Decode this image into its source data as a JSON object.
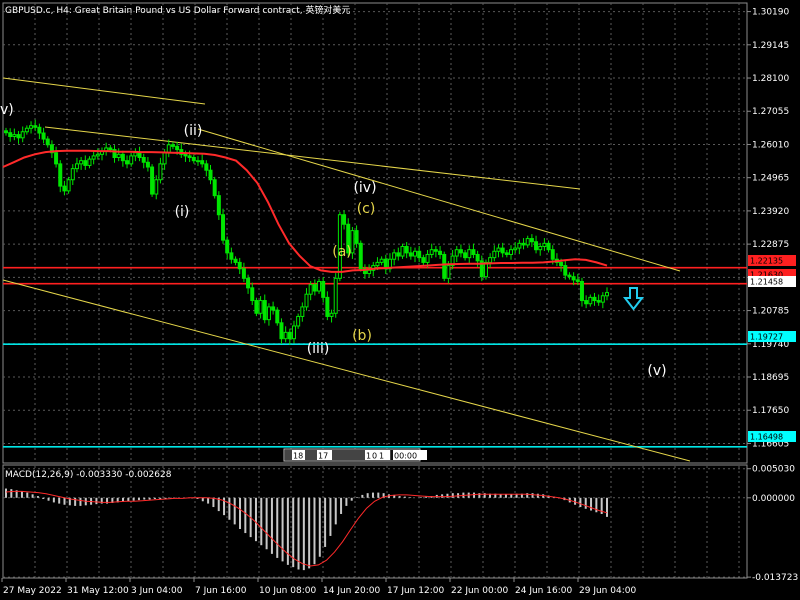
{
  "chart_data": {
    "type": "candlestick",
    "title": "GBPUSD.c, H4:  Great Britain Pound vs US Dollar Forward contract, 英镑对美元",
    "price_axis": {
      "ticks": [
        "1.30190",
        "1.29145",
        "1.28100",
        "1.27055",
        "1.26010",
        "1.24965",
        "1.23920",
        "1.22875",
        "1.21830",
        "1.20785",
        "1.19740",
        "1.18695",
        "1.17650",
        "1.16605"
      ],
      "range": [
        1.1599,
        1.3046
      ]
    },
    "price_labels": [
      {
        "value": "1.22135",
        "bg": "#ff2020"
      },
      {
        "value": "1.21630",
        "bg": "#ff2020"
      },
      {
        "value": "1.21458",
        "bg": "#ffffff"
      },
      {
        "value": "1.19727",
        "bg": "#00ffff"
      },
      {
        "value": "1.16498",
        "bg": "#00ffff"
      }
    ],
    "horizontal_lines": [
      {
        "price": 1.22135,
        "color": "#ff2020"
      },
      {
        "price": 1.2163,
        "color": "#ff2020"
      },
      {
        "price": 1.19727,
        "color": "#00e6e6"
      },
      {
        "price": 1.16498,
        "color": "#00e6e6"
      }
    ],
    "time_axis": [
      "27 May 2022",
      "31 May 12:00",
      "3 Jun 04:00",
      "7 Jun 16:00",
      "10 Jun 08:00",
      "14 Jun 20:00",
      "17 Jun 12:00",
      "22 Jun 00:00",
      "24 Jun 16:00",
      "29 Jun 04:00"
    ],
    "candles_close": [
      1.2638,
      1.2626,
      1.2632,
      1.2622,
      1.2641,
      1.2652,
      1.266,
      1.2655,
      1.2637,
      1.2618,
      1.26,
      1.2575,
      1.254,
      1.247,
      1.2455,
      1.249,
      1.2525,
      1.254,
      1.255,
      1.2535,
      1.2555,
      1.2565,
      1.257,
      1.258,
      1.259,
      1.2585,
      1.256,
      1.257,
      1.255,
      1.254,
      1.2565,
      1.2575,
      1.256,
      1.2545,
      1.253,
      1.2445,
      1.249,
      1.254,
      1.2575,
      1.26,
      1.2595,
      1.2585,
      1.257,
      1.2565,
      1.256,
      1.255,
      1.255,
      1.254,
      1.252,
      1.249,
      1.244,
      1.238,
      1.23,
      1.226,
      1.224,
      1.223,
      1.221,
      1.218,
      1.215,
      1.211,
      1.207,
      1.211,
      1.205,
      1.209,
      1.208,
      1.204,
      1.199,
      1.201,
      1.199,
      1.203,
      1.206,
      1.209,
      1.213,
      1.216,
      1.214,
      1.217,
      1.212,
      1.206,
      1.207,
      1.218,
      1.238,
      1.235,
      1.226,
      1.233,
      1.229,
      1.221,
      1.2195,
      1.2205,
      1.222,
      1.223,
      1.224,
      1.221,
      1.224,
      1.226,
      1.225,
      1.228,
      1.226,
      1.225,
      1.2265,
      1.2245,
      1.223,
      1.2255,
      1.227,
      1.2265,
      1.2255,
      1.218,
      1.222,
      1.225,
      1.227,
      1.226,
      1.2245,
      1.227,
      1.2255,
      1.2235,
      1.2185,
      1.223,
      1.2245,
      1.2265,
      1.2275,
      1.226,
      1.2255,
      1.227,
      1.2275,
      1.229,
      1.2285,
      1.2305,
      1.2295,
      1.227,
      1.228,
      1.229,
      1.227,
      1.224,
      1.223,
      1.222,
      1.219,
      1.2185,
      1.2175,
      1.217,
      1.211,
      1.21,
      1.212,
      1.211,
      1.2105,
      1.2125,
      1.2135
    ],
    "ma_close": [
      1.253,
      1.2545,
      1.256,
      1.257,
      1.2577,
      1.258,
      1.2581,
      1.2581,
      1.2581,
      1.258,
      1.258,
      1.2578,
      1.2578,
      1.2577,
      1.2577,
      1.2576,
      1.2575,
      1.2574,
      1.2573,
      1.2572,
      1.2568,
      1.256,
      1.255,
      1.252,
      1.248,
      1.242,
      1.235,
      1.229,
      1.225,
      1.2218,
      1.2205,
      1.22,
      1.22,
      1.2205,
      1.2206,
      1.221,
      1.2212,
      1.2214,
      1.2216,
      1.2218,
      1.222,
      1.2222,
      1.2224,
      1.2225,
      1.2226,
      1.2226,
      1.2227,
      1.2228,
      1.2228,
      1.2229,
      1.2229,
      1.223,
      1.2233,
      1.2237,
      1.224,
      1.2238,
      1.223,
      1.222
    ],
    "wave_labels": [
      {
        "text": "(ii)",
        "color": "#ffffff"
      },
      {
        "text": "(i)",
        "color": "#ffffff"
      },
      {
        "text": "(iii)",
        "color": "#ffffff"
      },
      {
        "text": "(iv)",
        "color": "#ffffff"
      },
      {
        "text": "(v)",
        "color": "#ffffff"
      },
      {
        "text": "(a)",
        "color": "#e5d64a"
      },
      {
        "text": "(b)",
        "color": "#e5d64a"
      },
      {
        "text": "(c)",
        "color": "#e5d64a"
      },
      {
        "text": "v)",
        "color": "#ffffff"
      }
    ],
    "trendline_color": "#e5d64a",
    "scroll_labels": [
      "18",
      "17",
      "1",
      "0",
      "1",
      "00:00"
    ],
    "macd": {
      "label": "MACD(12,26,9) -0.003330 -0.002628",
      "ticks": [
        "0.005030",
        "0.000000",
        "-0.013723"
      ],
      "range": [
        -0.0137,
        0.0055
      ],
      "histogram": [
        0.0016,
        0.0015,
        0.0013,
        0.0011,
        0.0009,
        0.0006,
        0.0003,
        -0.0002,
        -0.0005,
        -0.0008,
        -0.001,
        -0.0012,
        -0.0013,
        -0.0014,
        -0.0014,
        -0.0013,
        -0.0012,
        -0.0011,
        -0.001,
        -0.001,
        -0.0009,
        -0.0008,
        -0.0007,
        -0.0006,
        -0.0005,
        -0.0004,
        -0.0003,
        -0.0003,
        -0.0002,
        -0.0002,
        -0.0002,
        -0.0001,
        -0.0001,
        0.0,
        0.0,
        -0.0001,
        -0.0002,
        -0.0006,
        -0.001,
        -0.0016,
        -0.0023,
        -0.003,
        -0.0038,
        -0.0046,
        -0.0054,
        -0.0061,
        -0.0068,
        -0.0075,
        -0.0082,
        -0.0089,
        -0.0097,
        -0.0104,
        -0.011,
        -0.0116,
        -0.012,
        -0.0124,
        -0.0125,
        -0.0122,
        -0.0115,
        -0.0102,
        -0.0085,
        -0.0066,
        -0.0046,
        -0.0028,
        -0.0014,
        -0.0005,
        0.0001,
        0.0005,
        0.0008,
        0.0009,
        0.0009,
        0.0008,
        0.0006,
        0.0005,
        0.0003,
        0.0002,
        0.0001,
        0.0,
        0.0001,
        0.0002,
        0.0003,
        0.0005,
        0.0006,
        0.0007,
        0.0008,
        0.0008,
        0.0009,
        0.0009,
        0.0009,
        0.0008,
        0.0008,
        0.0007,
        0.0007,
        0.0006,
        0.0006,
        0.0006,
        0.0007,
        0.0007,
        0.0008,
        0.0008,
        0.0007,
        0.0006,
        0.0004,
        0.0002,
        -0.0001,
        -0.0004,
        -0.0008,
        -0.0012,
        -0.0016,
        -0.0019,
        -0.0022,
        -0.0025,
        -0.0028,
        -0.0033
      ],
      "signal": [
        0.001,
        0.0011,
        0.0011,
        0.001,
        0.0009,
        0.0007,
        0.0004,
        0.0001,
        -0.0002,
        -0.0004,
        -0.0006,
        -0.0007,
        -0.0008,
        -0.0008,
        -0.0007,
        -0.0006,
        -0.0006,
        -0.0005,
        -0.0004,
        -0.0003,
        -0.0002,
        -0.0001,
        -0.0001,
        0.0,
        0.0,
        0.0,
        -0.0001,
        -0.0004,
        -0.001,
        -0.0018,
        -0.0028,
        -0.004,
        -0.0054,
        -0.0068,
        -0.0082,
        -0.0095,
        -0.0106,
        -0.0114,
        -0.0118,
        -0.0116,
        -0.0108,
        -0.0094,
        -0.0076,
        -0.0055,
        -0.0035,
        -0.0018,
        -0.0006,
        0.0001,
        0.0004,
        0.0005,
        0.0005,
        0.0004,
        0.0003,
        0.0002,
        0.0002,
        0.0002,
        0.0003,
        0.0004,
        0.0005,
        0.0006,
        0.0006,
        0.0006,
        0.0006,
        0.0006,
        0.0006,
        0.0006,
        0.0005,
        0.0004,
        0.0002,
        0.0,
        -0.0003,
        -0.0007,
        -0.0012,
        -0.0017,
        -0.0022,
        -0.0026
      ]
    }
  }
}
